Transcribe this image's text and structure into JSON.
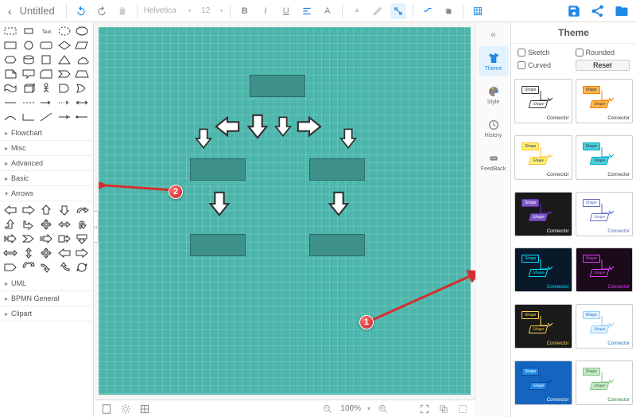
{
  "header": {
    "title": "Untitled",
    "font": "Helvetica",
    "size": "12"
  },
  "zoom": "100%",
  "sideTabs": {
    "theme": "Theme",
    "style": "Style",
    "history": "History",
    "feedback": "FeedBack"
  },
  "themePanel": {
    "title": "Theme",
    "sketch": "Sketch",
    "rounded": "Rounded",
    "curved": "Curved",
    "reset": "Reset",
    "shapeLabel": "Shape",
    "connectorLabel": "Connector"
  },
  "categories": {
    "flowchart": "Flowchart",
    "misc": "Misc",
    "advanced": "Advanced",
    "basic": "Basic",
    "arrows": "Arrows",
    "uml": "UML",
    "bpmn": "BPMN General",
    "clipart": "Clipart"
  },
  "annotations": {
    "badge1": "1",
    "badge2": "2"
  },
  "themes": [
    {
      "bg": "#ffffff",
      "shape": "#fff",
      "shapeBorder": "#333",
      "text": "#333"
    },
    {
      "bg": "#ffffff",
      "shape": "#ffb74d",
      "shapeBorder": "#f57c00",
      "text": "#333"
    },
    {
      "bg": "#ffffff",
      "shape": "#fff176",
      "shapeBorder": "#fbc02d",
      "text": "#333"
    },
    {
      "bg": "#ffffff",
      "shape": "#4dd0e1",
      "shapeBorder": "#00acc1",
      "text": "#333"
    },
    {
      "bg": "#1a1a1a",
      "shape": "#7e57c2",
      "shapeBorder": "#5e35b1",
      "text": "#fff"
    },
    {
      "bg": "#ffffff",
      "shape": "#fff",
      "shapeBorder": "#5c6bc0",
      "text": "#5c6bc0"
    },
    {
      "bg": "#0a1929",
      "shape": "#0a1929",
      "shapeBorder": "#00e5ff",
      "text": "#00e5ff"
    },
    {
      "bg": "#1a0a1a",
      "shape": "#1a0a1a",
      "shapeBorder": "#e040fb",
      "text": "#e040fb"
    },
    {
      "bg": "#1a1a1a",
      "shape": "#1a1a1a",
      "shapeBorder": "#ffd54f",
      "text": "#ffd54f"
    },
    {
      "bg": "#ffffff",
      "shape": "#e3f2fd",
      "shapeBorder": "#90caf9",
      "text": "#1976d2"
    },
    {
      "bg": "#1565c0",
      "shape": "#1e88e5",
      "shapeBorder": "#0d47a1",
      "text": "#fff"
    },
    {
      "bg": "#ffffff",
      "shape": "#c8e6c9",
      "shapeBorder": "#81c784",
      "text": "#2e7d32"
    }
  ]
}
